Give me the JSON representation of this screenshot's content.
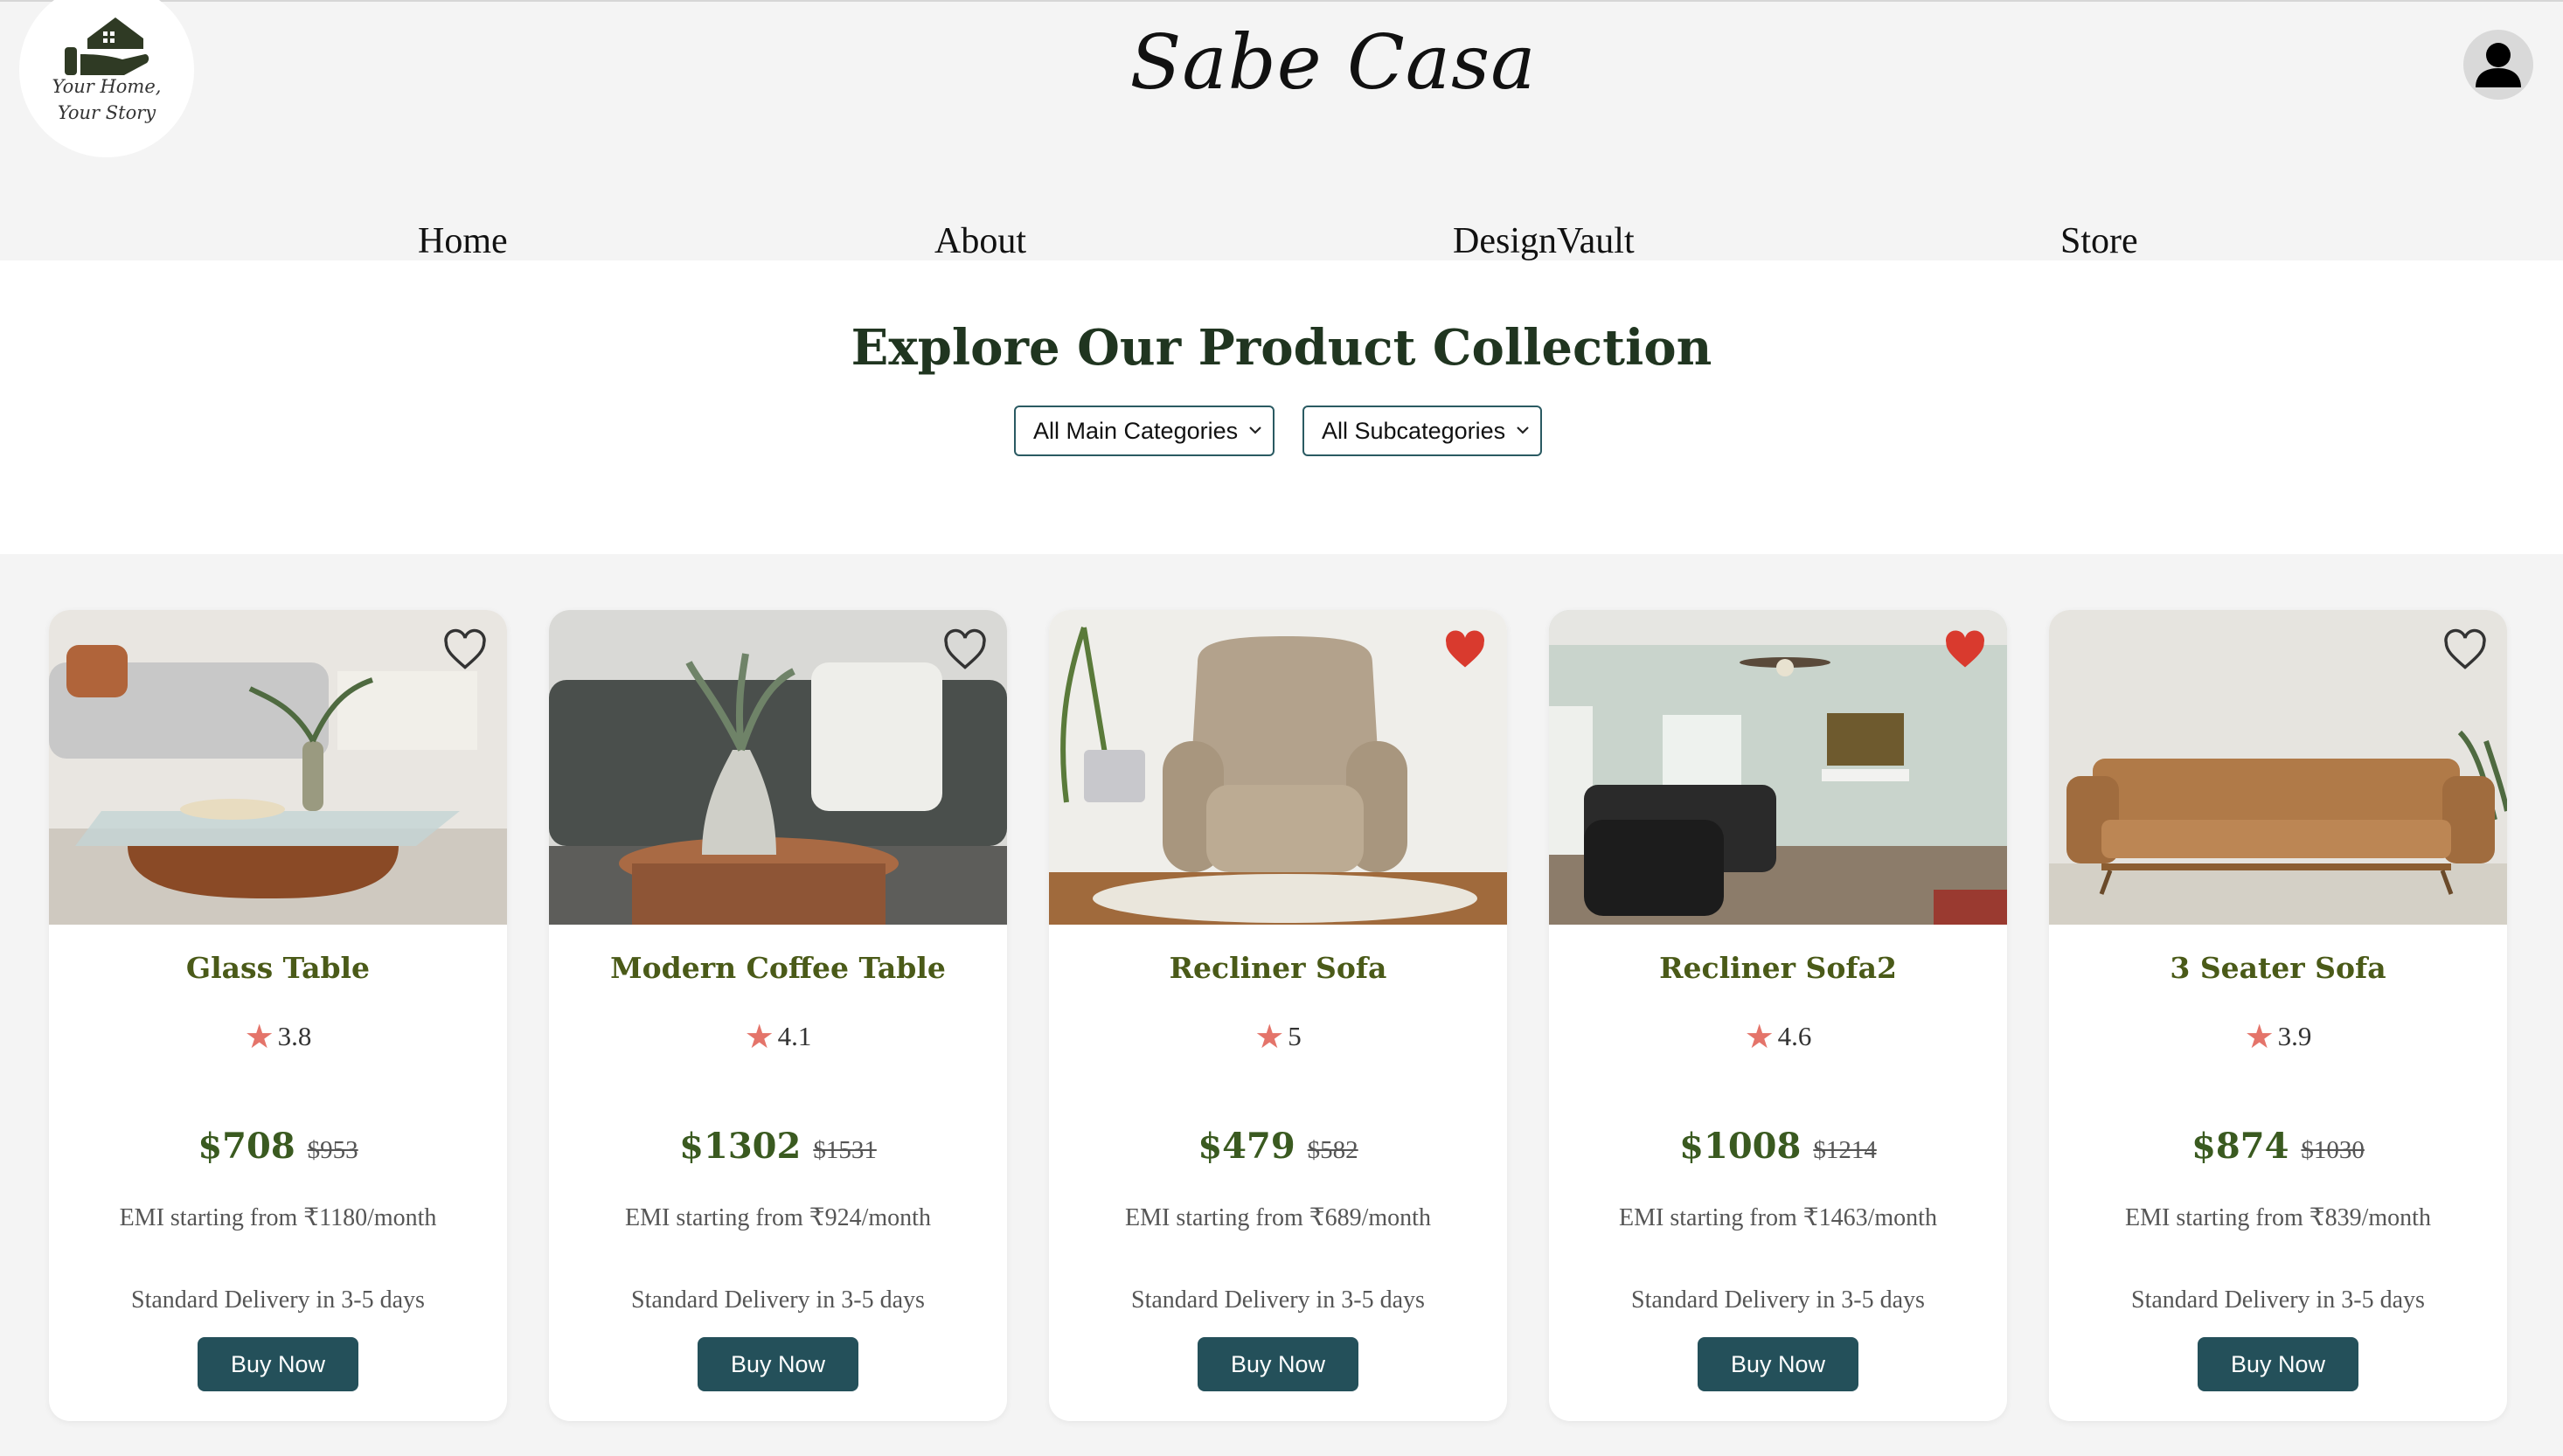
{
  "header": {
    "logo_tagline": [
      "Your Home,",
      "Your Story"
    ],
    "brand": "Sabe Casa",
    "profile_icon": "user-profile-icon"
  },
  "nav": [
    {
      "label": "Home"
    },
    {
      "label": "About"
    },
    {
      "label": "DesignVault"
    },
    {
      "label": "Store"
    }
  ],
  "hero": {
    "title": "Explore Our Product Collection",
    "main_category": "All Main Categories",
    "sub_category": "All Subcategories"
  },
  "colors": {
    "button": "#24505a",
    "product_name": "#4a5a18",
    "price": "#3a5a20",
    "star": "#e4746a",
    "heart_active": "#d93a2e"
  },
  "products": [
    {
      "name": "Glass Table",
      "rating": "3.8",
      "price": "$708",
      "old_price": "$953",
      "emi": "EMI starting from ₹1180/month",
      "delivery": "Standard Delivery in 3-5 days",
      "buy": "Buy Now",
      "favorited": false
    },
    {
      "name": "Modern Coffee Table",
      "rating": "4.1",
      "price": "$1302",
      "old_price": "$1531",
      "emi": "EMI starting from ₹924/month",
      "delivery": "Standard Delivery in 3-5 days",
      "buy": "Buy Now",
      "favorited": false
    },
    {
      "name": "Recliner Sofa",
      "rating": "5",
      "price": "$479",
      "old_price": "$582",
      "emi": "EMI starting from ₹689/month",
      "delivery": "Standard Delivery in 3-5 days",
      "buy": "Buy Now",
      "favorited": true
    },
    {
      "name": "Recliner Sofa2",
      "rating": "4.6",
      "price": "$1008",
      "old_price": "$1214",
      "emi": "EMI starting from ₹1463/month",
      "delivery": "Standard Delivery in 3-5 days",
      "buy": "Buy Now",
      "favorited": true
    },
    {
      "name": "3 Seater Sofa",
      "rating": "3.9",
      "price": "$874",
      "old_price": "$1030",
      "emi": "EMI starting from ₹839/month",
      "delivery": "Standard Delivery in 3-5 days",
      "buy": "Buy Now",
      "favorited": false
    }
  ]
}
